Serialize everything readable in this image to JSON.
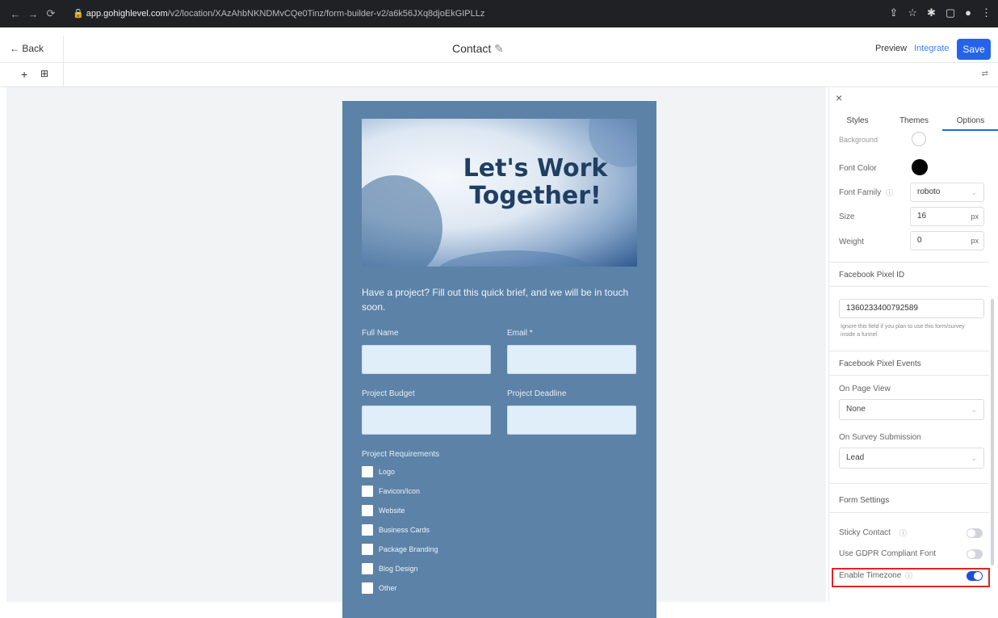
{
  "browser": {
    "url_host": "app.gohighlevel.com",
    "url_path": "/v2/location/XAzAhbNKNDMvCQe0Tinz/form-builder-v2/a6k56JXq8djoEkGIPLLz"
  },
  "topbar": {
    "back_label": "Back",
    "title": "Contact",
    "preview_label": "Preview",
    "integrate_label": "Integrate",
    "save_label": "Save"
  },
  "form": {
    "hero_title": "Let's Work Together!",
    "intro": "Have a project? Fill out this quick brief, and we will be in touch soon.",
    "fields": {
      "full_name": "Full Name",
      "email": "Email *",
      "budget": "Project Budget",
      "deadline": "Project Deadline",
      "requirements": "Project Requirements"
    },
    "checkboxes": [
      "Logo",
      "Favicon/Icon",
      "Website",
      "Business Cards",
      "Package Branding",
      "Blog Design",
      "Other"
    ]
  },
  "panel": {
    "tabs": [
      "Styles",
      "Themes",
      "Options"
    ],
    "background_label": "Background",
    "font_color_label": "Font Color",
    "font_color_value": "#000000",
    "font_family_label": "Font Family",
    "font_family_value": "roboto",
    "size_label": "Size",
    "size_value": "16",
    "size_unit": "px",
    "weight_label": "Weight",
    "weight_value": "0",
    "weight_unit": "px",
    "fb_pixel_id_label": "Facebook Pixel ID",
    "fb_pixel_id_value": "1360233400792589",
    "fb_pixel_helper": "Ignore this field if you plan to use this form/survey inside a funnel",
    "fb_pixel_events_label": "Facebook Pixel Events",
    "on_page_view_label": "On Page View",
    "on_page_view_value": "None",
    "on_survey_submission_label": "On Survey Submission",
    "on_survey_submission_value": "Lead",
    "form_settings_label": "Form Settings",
    "sticky_contact_label": "Sticky Contact",
    "sticky_contact_on": false,
    "gdpr_label": "Use GDPR Compliant Font",
    "gdpr_on": false,
    "timezone_label": "Enable Timezone",
    "timezone_on": true
  }
}
